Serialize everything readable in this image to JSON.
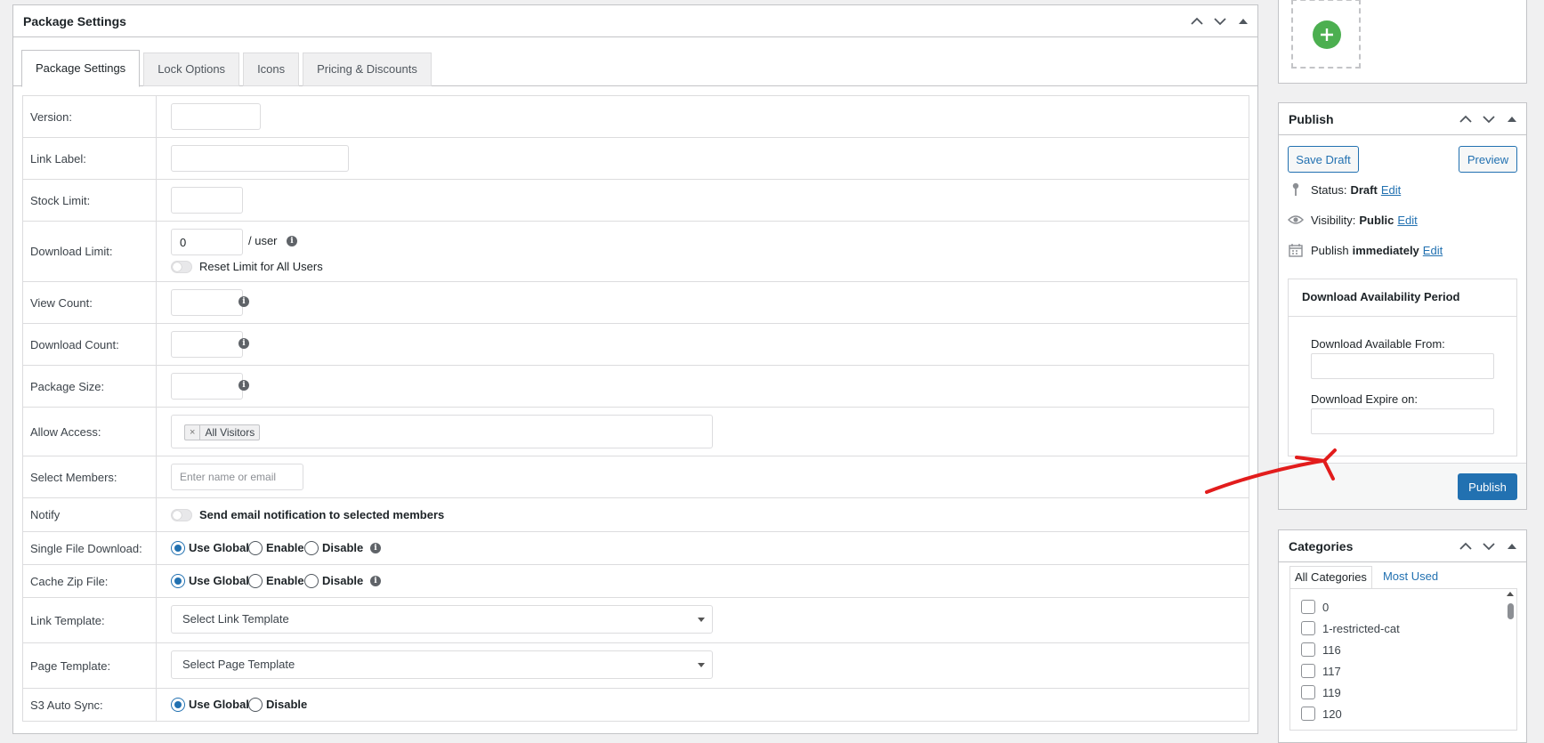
{
  "main": {
    "title": "Package Settings",
    "tabs": [
      {
        "label": "Package Settings",
        "active": true
      },
      {
        "label": "Lock Options"
      },
      {
        "label": "Icons"
      },
      {
        "label": "Pricing & Discounts"
      }
    ],
    "fields": {
      "version": {
        "label": "Version:",
        "value": ""
      },
      "link_label": {
        "label": "Link Label:",
        "value": ""
      },
      "stock_limit": {
        "label": "Stock Limit:",
        "value": ""
      },
      "download_limit": {
        "label": "Download Limit:",
        "value": "0",
        "suffix": "/ user",
        "reset_label": "Reset Limit for All Users"
      },
      "view_count": {
        "label": "View Count:",
        "value": ""
      },
      "download_count": {
        "label": "Download Count:",
        "value": ""
      },
      "package_size": {
        "label": "Package Size:",
        "value": ""
      },
      "allow_access": {
        "label": "Allow Access:",
        "chip": "All Visitors",
        "chip_remove": "×"
      },
      "select_members": {
        "label": "Select Members:",
        "placeholder": "Enter name or email"
      },
      "notify": {
        "label": "Notify",
        "toggle_label": "Send email notification to selected members"
      },
      "single_file_download": {
        "label": "Single File Download:",
        "options": [
          "Use Global",
          "Enable",
          "Disable"
        ],
        "selected": "Use Global"
      },
      "cache_zip_file": {
        "label": "Cache Zip File:",
        "options": [
          "Use Global",
          "Enable",
          "Disable"
        ],
        "selected": "Use Global"
      },
      "link_template": {
        "label": "Link Template:",
        "selected": "Select Link Template"
      },
      "page_template": {
        "label": "Page Template:",
        "selected": "Select Page Template"
      },
      "s3_auto_sync": {
        "label": "S3 Auto Sync:",
        "options": [
          "Use Global",
          "Disable"
        ],
        "selected": "Use Global"
      }
    }
  },
  "publish": {
    "title": "Publish",
    "save_draft": "Save Draft",
    "preview": "Preview",
    "status_label": "Status:",
    "status_value": "Draft",
    "visibility_label": "Visibility:",
    "visibility_value": "Public",
    "publish_label": "Publish",
    "publish_value": "immediately",
    "edit": "Edit",
    "availability": {
      "title": "Download Availability Period",
      "from_label": "Download Available From:",
      "from_value": "",
      "expire_label": "Download Expire on:",
      "expire_value": ""
    },
    "publish_button": "Publish"
  },
  "categories": {
    "title": "Categories",
    "tabs": [
      "All Categories",
      "Most Used"
    ],
    "items": [
      "0",
      "1-restricted-cat",
      "116",
      "117",
      "119",
      "120"
    ]
  },
  "colors": {
    "accent": "#2271b1",
    "add_button": "#4caf50",
    "annotation_arrow": "#e21c1c"
  },
  "icons": {
    "box_controls": [
      "chevron-up-icon",
      "chevron-down-icon",
      "triangle-up-icon"
    ],
    "add": "plus-icon",
    "info": "info-icon",
    "status": "pin-icon",
    "visibility": "eye-icon",
    "schedule": "calendar-icon"
  }
}
